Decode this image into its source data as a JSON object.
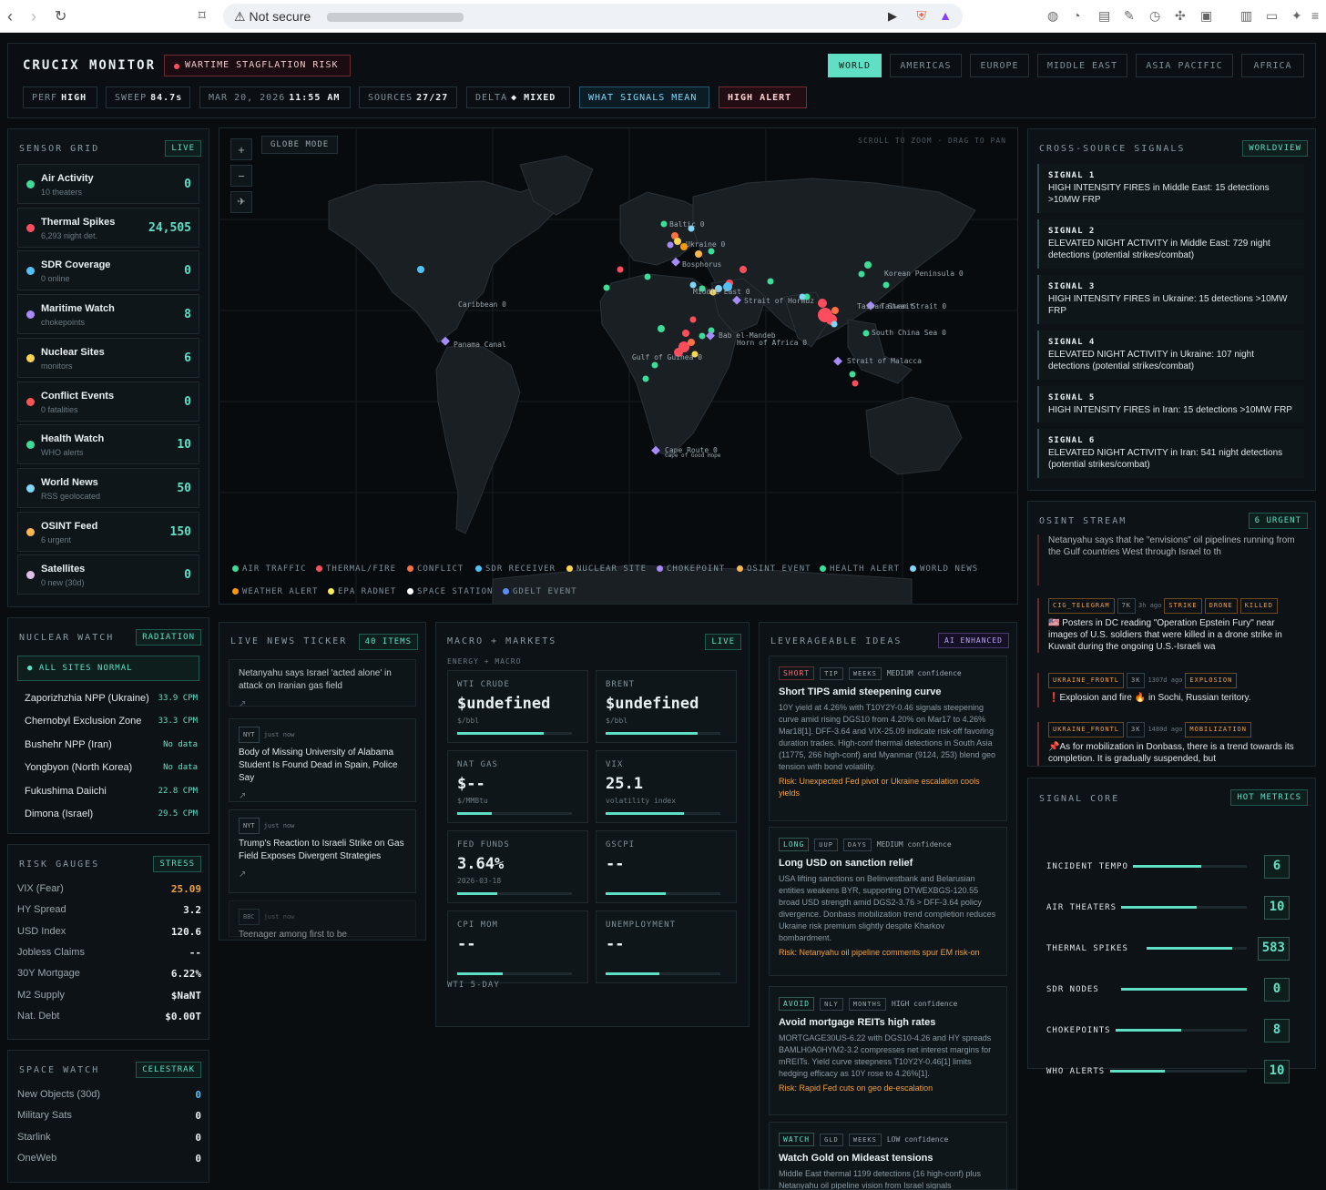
{
  "browser": {
    "security_label": "Not secure"
  },
  "header": {
    "brand": "CRUCIX MONITOR",
    "alert_pill": "WARTIME STAGFLATION RISK",
    "regions": [
      "WORLD",
      "AMERICAS",
      "EUROPE",
      "MIDDLE EAST",
      "ASIA PACIFIC",
      "AFRICA"
    ],
    "active_region": "WORLD",
    "stats": [
      {
        "label": "PERF",
        "value": "HIGH"
      },
      {
        "label": "SWEEP",
        "value": "84.7s"
      },
      {
        "label": "MAR 20, 2026",
        "value": "11:55 AM"
      },
      {
        "label": "SOURCES",
        "value": "27/27"
      },
      {
        "label": "DELTA",
        "value": "◆ MIXED"
      }
    ],
    "signals_btn": "WHAT SIGNALS MEAN",
    "high_alert_btn": "HIGH ALERT"
  },
  "sensor_grid": {
    "title": "SENSOR GRID",
    "badge": "LIVE",
    "items": [
      {
        "name": "Air Activity",
        "sub": "10 theaters",
        "value": "0",
        "color": "#3ddc97"
      },
      {
        "name": "Thermal Spikes",
        "sub": "6,293 night det.",
        "value": "24,505",
        "color": "#ff4d5e"
      },
      {
        "name": "SDR Coverage",
        "sub": "0 online",
        "value": "0",
        "color": "#4fc3f7"
      },
      {
        "name": "Maritime Watch",
        "sub": "chokepoints",
        "value": "8",
        "color": "#a78bfa"
      },
      {
        "name": "Nuclear Sites",
        "sub": "monitors",
        "value": "6",
        "color": "#ffd54f"
      },
      {
        "name": "Conflict Events",
        "sub": "0 fatalities",
        "value": "0",
        "color": "#ff5252"
      },
      {
        "name": "Health Watch",
        "sub": "WHO alerts",
        "value": "10",
        "color": "#3ddc97"
      },
      {
        "name": "World News",
        "sub": "RSS geolocated",
        "value": "50",
        "color": "#81d4fa"
      },
      {
        "name": "OSINT Feed",
        "sub": "6 urgent",
        "value": "150",
        "color": "#ffb74d"
      },
      {
        "name": "Satellites",
        "sub": "0 new (30d)",
        "value": "0",
        "color": "#e1bee7"
      }
    ]
  },
  "nuclear_watch": {
    "title": "NUCLEAR WATCH",
    "badge": "RADIATION",
    "status": "● ALL SITES NORMAL",
    "sites": [
      {
        "name": "Zaporizhzhia NPP (Ukraine)",
        "value": "33.9 CPM"
      },
      {
        "name": "Chernobyl Exclusion Zone",
        "value": "33.3 CPM"
      },
      {
        "name": "Bushehr NPP (Iran)",
        "value": "No data"
      },
      {
        "name": "Yongbyon (North Korea)",
        "value": "No data"
      },
      {
        "name": "Fukushima Daiichi",
        "value": "22.8 CPM"
      },
      {
        "name": "Dimona (Israel)",
        "value": "29.5 CPM"
      }
    ]
  },
  "risk_gauges": {
    "title": "RISK GAUGES",
    "badge": "STRESS",
    "rows": [
      {
        "name": "VIX (Fear)",
        "value": "25.09",
        "color": "#f0a040"
      },
      {
        "name": "HY Spread",
        "value": "3.2",
        "color": "#e8f0f2"
      },
      {
        "name": "USD Index",
        "value": "120.6",
        "color": "#e8f0f2"
      },
      {
        "name": "Jobless Claims",
        "value": "--",
        "color": "#e8f0f2"
      },
      {
        "name": "30Y Mortgage",
        "value": "6.22%",
        "color": "#e8f0f2"
      },
      {
        "name": "M2 Supply",
        "value": "$NaNT",
        "color": "#e8f0f2"
      },
      {
        "name": "Nat. Debt",
        "value": "$0.00T",
        "color": "#e8f0f2"
      }
    ]
  },
  "space_watch": {
    "title": "SPACE WATCH",
    "badge": "CELESTRAK",
    "rows": [
      {
        "name": "New Objects (30d)",
        "value": "0",
        "color": "#4fc3f7"
      },
      {
        "name": "Military Sats",
        "value": "0",
        "color": "#e8f0f2"
      },
      {
        "name": "Starlink",
        "value": "0",
        "color": "#e8f0f2"
      },
      {
        "name": "OneWeb",
        "value": "0",
        "color": "#e8f0f2"
      }
    ]
  },
  "map": {
    "mode_label": "GLOBE MODE",
    "hint": "SCROLL TO ZOOM · DRAG TO PAN",
    "zoom_in": "+",
    "zoom_out": "−",
    "labels": [
      "Baltic 0",
      "Ukraine 0",
      "Bosphorus",
      "Korean Peninsula 0",
      "Caribbean 0",
      "Middle East 0",
      "Strait of Hormuz",
      "Taiwan Strait 0",
      "Taiwan Strait",
      "Panama Canal",
      "Bab el-Mandeb",
      "Horn of Africa 0",
      "South China Sea 0",
      "Gulf of Guinea 0",
      "Strait of Malacca",
      "Cape Route 0",
      "Cape of Good Hope"
    ],
    "legend": [
      {
        "label": "AIR TRAFFIC",
        "color": "#3ddc97"
      },
      {
        "label": "THERMAL/FIRE",
        "color": "#ff4d5e"
      },
      {
        "label": "CONFLICT",
        "color": "#ff7043"
      },
      {
        "label": "SDR RECEIVER",
        "color": "#4fc3f7"
      },
      {
        "label": "NUCLEAR SITE",
        "color": "#ffd54f"
      },
      {
        "label": "CHOKEPOINT",
        "color": "#a78bfa"
      },
      {
        "label": "OSINT EVENT",
        "color": "#ffb74d"
      },
      {
        "label": "HEALTH ALERT",
        "color": "#3ddc97"
      },
      {
        "label": "WORLD NEWS",
        "color": "#81d4fa"
      },
      {
        "label": "WEATHER ALERT",
        "color": "#ff9800"
      },
      {
        "label": "EPA RADNET",
        "color": "#ffee58"
      },
      {
        "label": "SPACE STATION",
        "color": "#ffffff"
      },
      {
        "label": "GDELT EVENT",
        "color": "#5c8df6"
      }
    ]
  },
  "signals": {
    "title": "CROSS-SOURCE SIGNALS",
    "badge": "WORLDVIEW",
    "items": [
      {
        "title": "SIGNAL 1",
        "text": "HIGH INTENSITY FIRES in Middle East: 15 detections >10MW FRP"
      },
      {
        "title": "SIGNAL 2",
        "text": "ELEVATED NIGHT ACTIVITY in Middle East: 729 night detections (potential strikes/combat)"
      },
      {
        "title": "SIGNAL 3",
        "text": "HIGH INTENSITY FIRES in Ukraine: 15 detections >10MW FRP"
      },
      {
        "title": "SIGNAL 4",
        "text": "ELEVATED NIGHT ACTIVITY in Ukraine: 107 night detections (potential strikes/combat)"
      },
      {
        "title": "SIGNAL 5",
        "text": "HIGH INTENSITY FIRES in Iran: 15 detections >10MW FRP"
      },
      {
        "title": "SIGNAL 6",
        "text": "ELEVATED NIGHT ACTIVITY in Iran: 541 night detections (potential strikes/combat)"
      }
    ]
  },
  "osint": {
    "title": "OSINT STREAM",
    "badge": "6 URGENT",
    "items": [
      {
        "tags": [],
        "text": "Netanyahu says that he \"envisions\" oil pipelines running from the Gulf countries West through Israel to th"
      },
      {
        "tags": [
          "CIG_TELEGRAM",
          "7K",
          "3h ago",
          "STRIKE",
          "DRONE",
          "KILLED"
        ],
        "text": "🇺🇸 Posters in DC reading \"Operation Epstein Fury\" near images of U.S. soldiers that were killed in a drone strike in Kuwait during the ongoing U.S.-Israeli wa"
      },
      {
        "tags": [
          "UKRAINE_FRONTL",
          "3K",
          "1307d ago",
          "EXPLOSION"
        ],
        "text": "❗Explosion and fire 🔥 in Sochi, Russian teritory."
      },
      {
        "tags": [
          "UKRAINE_FRONTL",
          "3K",
          "1480d ago",
          "MOBILIZATION"
        ],
        "text": "📌As for mobilization in Donbass, there is a trend towards its completion. It is gradually suspended, but"
      }
    ]
  },
  "core": {
    "title": "SIGNAL CORE",
    "badge": "HOT METRICS",
    "items": [
      {
        "label": "INCIDENT TEMPO",
        "value": "6",
        "fill": 0.6
      },
      {
        "label": "AIR THEATERS",
        "value": "10",
        "fill": 0.6
      },
      {
        "label": "THERMAL SPIKES",
        "value": "583",
        "fill": 0.85
      },
      {
        "label": "SDR NODES",
        "value": "0",
        "fill": 1.0
      },
      {
        "label": "CHOKEPOINTS",
        "value": "8",
        "fill": 0.5
      },
      {
        "label": "WHO ALERTS",
        "value": "10",
        "fill": 0.4
      }
    ]
  },
  "ticker": {
    "title": "LIVE NEWS TICKER",
    "badge": "40 ITEMS",
    "items": [
      {
        "source": "",
        "time": "",
        "text": "Netanyahu says Israel 'acted alone' in attack on Iranian gas field"
      },
      {
        "source": "NYT",
        "time": "just now",
        "text": "Body of Missing University of Alabama Student Is Found Dead in Spain, Police Say"
      },
      {
        "source": "NYT",
        "time": "just now",
        "text": "Trump's Reaction to Israeli Strike on Gas Field Exposes Divergent Strategies"
      },
      {
        "source": "BBC",
        "time": "just now",
        "text": "Teenager among first to be"
      }
    ]
  },
  "macro": {
    "title": "MACRO + MARKETS",
    "badge": "LIVE",
    "subtitle": "ENERGY + MACRO",
    "footer": "WTI 5-DAY",
    "cards": [
      {
        "label": "WTI CRUDE",
        "value": "$undefined",
        "unit": "$/bbl",
        "fill": 0.75
      },
      {
        "label": "BRENT",
        "value": "$undefined",
        "unit": "$/bbl",
        "fill": 0.8
      },
      {
        "label": "NAT GAS",
        "value": "$--",
        "unit": "$/MMBtu",
        "fill": 0.3
      },
      {
        "label": "VIX",
        "value": "25.1",
        "unit": "volatility index",
        "fill": 0.68
      },
      {
        "label": "FED FUNDS",
        "value": "3.64%",
        "unit": "2026-03-18",
        "fill": 0.35
      },
      {
        "label": "GSCPI",
        "value": "--",
        "unit": "",
        "fill": 0.52
      },
      {
        "label": "CPI MOM",
        "value": "--",
        "unit": "",
        "fill": 0.4
      },
      {
        "label": "UNEMPLOYMENT",
        "value": "--",
        "unit": "",
        "fill": 0.47
      }
    ]
  },
  "ideas": {
    "title": "LEVERAGEABLE IDEAS",
    "badge": "AI ENHANCED",
    "items": [
      {
        "action": "SHORT",
        "ticker": "TIP",
        "horizon": "WEEKS",
        "confidence": "MEDIUM confidence",
        "title": "Short TIPS amid steepening curve",
        "body": "10Y yield at 4.26% with T10Y2Y-0.46 signals steepening curve amid rising DGS10 from 4.20% on Mar17 to 4.26% Mar18[1]. DFF-3.64 and VIX-25.09 indicate risk-off favoring duration trades. High-conf thermal detections in South Asia (11775, 266 high-conf) and Myanmar (9124, 253) blend geo tension with bond volatility.",
        "risk": "Risk: Unexpected Fed pivot or Ukraine escalation cools yields"
      },
      {
        "action": "LONG",
        "ticker": "UUP",
        "horizon": "DAYS",
        "confidence": "MEDIUM confidence",
        "title": "Long USD on sanction relief",
        "body": "USA lifting sanctions on Belinvestbank and Belarusian entities weakens BYR, supporting DTWEXBGS-120.55 broad USD strength amid DGS2-3.76 > DFF-3.64 policy divergence. Donbass mobilization trend completion reduces Ukraine risk premium slightly despite Kharkov bombardment.",
        "risk": "Risk: Netanyahu oil pipeline comments spur EM risk-on"
      },
      {
        "action": "AVOID",
        "ticker": "NLY",
        "horizon": "MONTHS",
        "confidence": "HIGH confidence",
        "title": "Avoid mortgage REITs high rates",
        "body": "MORTGAGE30US-6.22 with DGS10-4.26 and HY spreads BAMLH0A0HYM2-3.2 compresses net interest margins for mREITs. Yield curve steepness T10Y2Y-0.46[1] limits hedging efficacy as 10Y rose to 4.26%[1].",
        "risk": "Risk: Rapid Fed cuts on geo de-escalation"
      },
      {
        "action": "WATCH",
        "ticker": "GLD",
        "horizon": "WEEKS",
        "confidence": "LOW confidence",
        "title": "Watch Gold on Mideast tensions",
        "body": "Middle East thermal 1199 detections (16 high-conf) plus Netanyahu oil pipeline vision from Israel signals",
        "risk": ""
      }
    ]
  }
}
